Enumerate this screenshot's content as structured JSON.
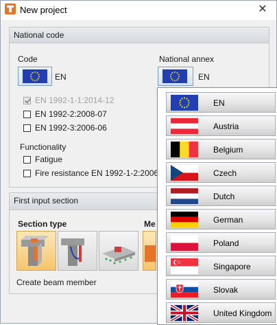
{
  "window": {
    "title": "New project"
  },
  "national_code": {
    "header": "National code",
    "code_label": "Code",
    "code_value": "EN",
    "annex_label": "National annex",
    "annex_value": "EN",
    "standards": [
      {
        "label": "EN 1992-1-1:2014-12",
        "checked": true,
        "disabled": true
      },
      {
        "label": "EN 1992-2:2008-07",
        "checked": false,
        "disabled": false
      },
      {
        "label": "EN 1992-3:2006-06",
        "checked": false,
        "disabled": false
      }
    ],
    "functionality_label": "Functionality",
    "functionality": [
      {
        "label": "Fatigue",
        "checked": false
      },
      {
        "label": "Fire resistance EN 1992-1-2:2006-",
        "checked": false
      }
    ]
  },
  "first_input": {
    "header": "First input section",
    "section_type_label": "Section type",
    "me_label": "Me",
    "create_label": "Create beam member"
  },
  "annex_dropdown": {
    "items": [
      {
        "name": "EN",
        "flag": "eu"
      },
      {
        "name": "Austria",
        "flag": "austria"
      },
      {
        "name": "Belgium",
        "flag": "belgium"
      },
      {
        "name": "Czech",
        "flag": "czech"
      },
      {
        "name": "Dutch",
        "flag": "dutch"
      },
      {
        "name": "German",
        "flag": "german"
      },
      {
        "name": "Poland",
        "flag": "poland"
      },
      {
        "name": "Singapore",
        "flag": "singapore"
      },
      {
        "name": "Slovak",
        "flag": "slovak"
      },
      {
        "name": "United Kingdom",
        "flag": "uk"
      }
    ]
  },
  "colors": {
    "eu_blue": "#1f3fb3",
    "eu_star": "#ffd200",
    "accent_orange": "#e8742a",
    "selection_border": "#7a9bc6"
  }
}
